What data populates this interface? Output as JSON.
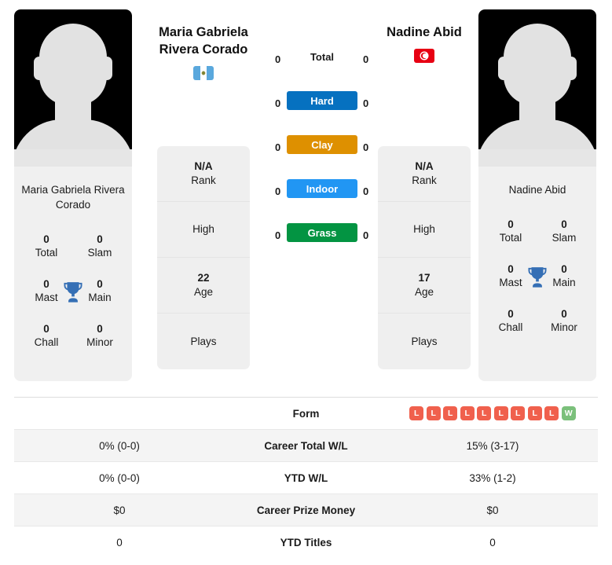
{
  "players": {
    "left": {
      "name": "Maria Gabriela Rivera Corado",
      "name_line1": "Maria Gabriela",
      "name_line2": "Rivera Corado",
      "country_code": "GT",
      "country_name": "Guatemala",
      "flag_icon": "guatemala-flag-icon",
      "titles": {
        "total_value": "0",
        "total_label": "Total",
        "slam_value": "0",
        "slam_label": "Slam",
        "mast_value": "0",
        "mast_label": "Mast",
        "main_value": "0",
        "main_label": "Main",
        "chall_value": "0",
        "chall_label": "Chall",
        "minor_value": "0",
        "minor_label": "Minor"
      },
      "info": [
        {
          "value": "N/A",
          "label": "Rank"
        },
        {
          "value": "",
          "label": "High"
        },
        {
          "value": "22",
          "label": "Age"
        },
        {
          "value": "",
          "label": "Plays"
        }
      ]
    },
    "right": {
      "name": "Nadine Abid",
      "name_line1": "Nadine Abid",
      "name_line2": "",
      "country_code": "TN",
      "country_name": "Tunisia",
      "flag_icon": "tunisia-flag-icon",
      "titles": {
        "total_value": "0",
        "total_label": "Total",
        "slam_value": "0",
        "slam_label": "Slam",
        "mast_value": "0",
        "mast_label": "Mast",
        "main_value": "0",
        "main_label": "Main",
        "chall_value": "0",
        "chall_label": "Chall",
        "minor_value": "0",
        "minor_label": "Minor"
      },
      "info": [
        {
          "value": "N/A",
          "label": "Rank"
        },
        {
          "value": "",
          "label": "High"
        },
        {
          "value": "17",
          "label": "Age"
        },
        {
          "value": "",
          "label": "Plays"
        }
      ]
    }
  },
  "surfaces": [
    {
      "label": "Total",
      "left": "0",
      "right": "0",
      "color": "transparent",
      "text_color": "#1b1b1b"
    },
    {
      "label": "Hard",
      "left": "0",
      "right": "0",
      "color": "#0671C0",
      "text_color": "#ffffff"
    },
    {
      "label": "Clay",
      "left": "0",
      "right": "0",
      "color": "#DE9000",
      "text_color": "#ffffff"
    },
    {
      "label": "Indoor",
      "left": "0",
      "right": "0",
      "color": "#2196F3",
      "text_color": "#ffffff"
    },
    {
      "label": "Grass",
      "left": "0",
      "right": "0",
      "color": "#039442",
      "text_color": "#ffffff"
    }
  ],
  "stats_table": {
    "form_row": {
      "label": "Form",
      "left_value": "",
      "right_badges": [
        {
          "text": "L",
          "result": "loss"
        },
        {
          "text": "L",
          "result": "loss"
        },
        {
          "text": "L",
          "result": "loss"
        },
        {
          "text": "L",
          "result": "loss"
        },
        {
          "text": "L",
          "result": "loss"
        },
        {
          "text": "L",
          "result": "loss"
        },
        {
          "text": "L",
          "result": "loss"
        },
        {
          "text": "L",
          "result": "loss"
        },
        {
          "text": "L",
          "result": "loss"
        },
        {
          "text": "W",
          "result": "win"
        }
      ]
    },
    "rows": [
      {
        "label": "Career Total W/L",
        "left": "0% (0-0)",
        "right": "15% (3-17)"
      },
      {
        "label": "YTD W/L",
        "left": "0% (0-0)",
        "right": "33% (1-2)"
      },
      {
        "label": "Career Prize Money",
        "left": "$0",
        "right": "$0"
      },
      {
        "label": "YTD Titles",
        "left": "0",
        "right": "0"
      }
    ]
  },
  "colors": {
    "loss_badge": "#F0604D",
    "win_badge": "#7BC07B",
    "trophy": "#356FB5",
    "card_bg": "#efefef"
  }
}
